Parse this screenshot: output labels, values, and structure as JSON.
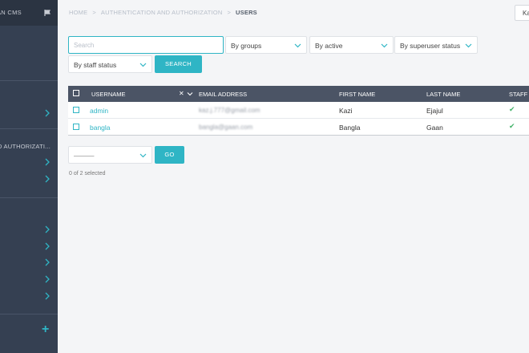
{
  "sidebar": {
    "title": "AN CMS",
    "sections": [
      "D AUTHORIZATI..."
    ],
    "add_label": "+"
  },
  "breadcrumb": [
    "HOME",
    "AUTHENTICATION AND AUTHORIZATION",
    "USERS"
  ],
  "user_button": "Ka",
  "search": {
    "placeholder": "Search",
    "button": "SEARCH"
  },
  "filters": [
    "By groups",
    "By active",
    "By superuser status",
    "By staff status"
  ],
  "table": {
    "columns": [
      "USERNAME",
      "EMAIL ADDRESS",
      "FIRST NAME",
      "LAST NAME",
      "STAFF"
    ],
    "rows": [
      {
        "username": "admin",
        "email": "kaz.j.777@gmail.com",
        "first": "Kazi",
        "last": "Ejajul",
        "staff": "✔"
      },
      {
        "username": "bangla",
        "email": "bangla@gaan.com",
        "first": "Bangla",
        "last": "Gaan",
        "staff": "✔"
      }
    ]
  },
  "actions": {
    "select_value": "———",
    "go_button": "GO"
  },
  "selection_status": "0 of 2 selected",
  "colors": {
    "accent": "#2fb5c5",
    "sidebar": "#354052",
    "table_header": "#4b5465",
    "check": "#44b36a"
  }
}
